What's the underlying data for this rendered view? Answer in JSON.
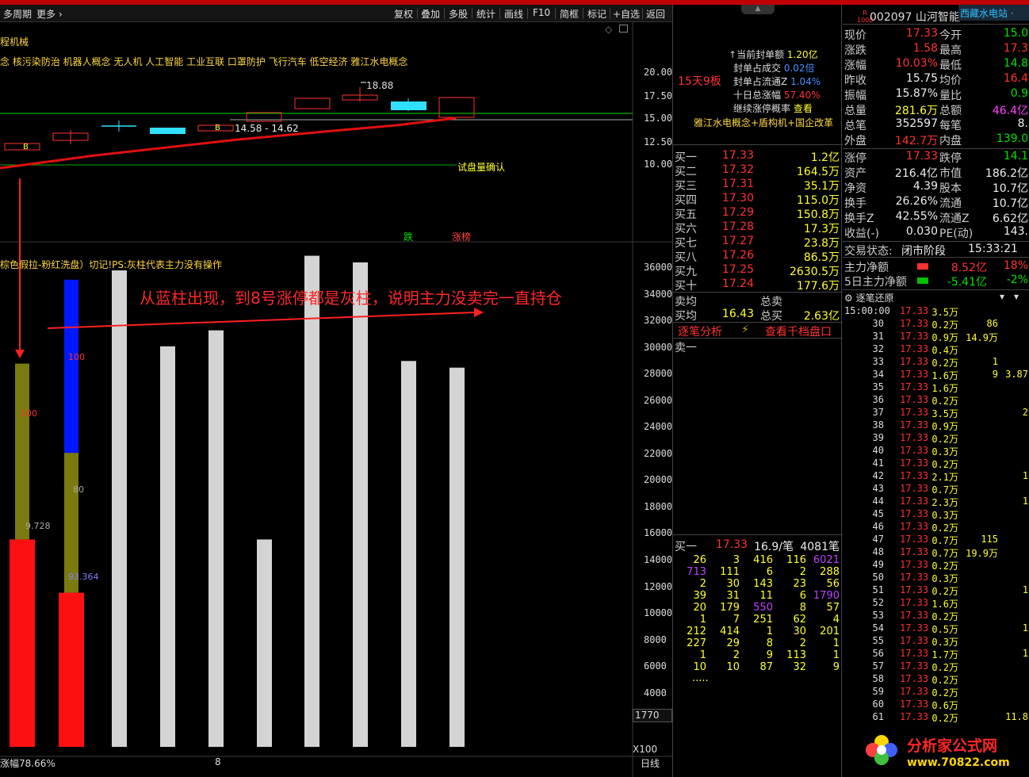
{
  "toolbar": {
    "left_partial": "多周期",
    "more": "更多",
    "buttons": [
      "复权",
      "叠加",
      "多股",
      "统计",
      "画线",
      "F10",
      "简框",
      "标记",
      "+自选",
      "返回"
    ]
  },
  "chart": {
    "sector": "程机械",
    "concepts": "念 核污染防治 机器人概念 无人机 人工智能 工业互联 口罩防护 飞行汽车 低空经济 雅江水电概念",
    "price_axis": [
      "20.00",
      "17.50",
      "15.00",
      "12.50",
      "10.00"
    ],
    "peak_label": "18.88",
    "range_label": "14.58 - 14.62",
    "confirm_label": "试盘量确认",
    "b_label": "B",
    "fall_label": "跌",
    "limit_label": "涨榜",
    "indicator_hint": "棕色假拉-粉红洗盘）切记!PS:灰柱代表主力没有操作",
    "annotation": "从蓝柱出现，到8号涨停都是灰柱，说明主力没卖完一直持仓",
    "vol_axis": [
      "36000",
      "34000",
      "32000",
      "30000",
      "28000",
      "26000",
      "24000",
      "22000",
      "20000",
      "18000",
      "16000",
      "14000",
      "12000",
      "10000",
      "8000",
      "6000",
      "4000"
    ],
    "bar_val_1": "100",
    "bar_val_2": "100",
    "bar_val_3": "100",
    "bar_val_4": "80",
    "bar_val_5": "9.728",
    "bar_val_6": "93.364",
    "box_value": "1770",
    "bottom_left": "涨幅78.66%",
    "date_mark": "8",
    "x100": "X100",
    "day_line": "日线"
  },
  "chart_data": {
    "type": "bar",
    "series": [
      {
        "name": "olive",
        "values": [
          28700,
          22000
        ]
      },
      {
        "name": "red",
        "values": [
          15500,
          11500
        ]
      },
      {
        "name": "blue",
        "values": [
          null,
          35000
        ]
      },
      {
        "name": "gray",
        "values": [
          35700,
          30000,
          31200,
          15500,
          36800,
          36300,
          28900,
          28400
        ]
      }
    ]
  },
  "stock": {
    "code": "002097",
    "name": "山河智能",
    "badge_top": "R",
    "badge_bot": "1000",
    "sector_tag": "西藏水电站"
  },
  "limit": {
    "days": "15天9板",
    "seal_amount_label": "当前封单额",
    "seal_amount": "1.20亿",
    "seal_ratio_label": "封单占成交",
    "seal_ratio": "0.02倍",
    "seal_float_label": "封单占流通Z",
    "seal_float": "1.04%",
    "ten_day_label": "十日总涨幅",
    "ten_day": "57.40%",
    "prob_label": "继续涨停概率",
    "prob_link": "查看",
    "tags": "雅江水电概念+盾构机+国企改革"
  },
  "bids": [
    {
      "l": "买一",
      "p": "17.33",
      "v": "1.2亿"
    },
    {
      "l": "买二",
      "p": "17.32",
      "v": "164.5万"
    },
    {
      "l": "买三",
      "p": "17.31",
      "v": "35.1万"
    },
    {
      "l": "买四",
      "p": "17.30",
      "v": "115.0万"
    },
    {
      "l": "买五",
      "p": "17.29",
      "v": "150.8万"
    },
    {
      "l": "买六",
      "p": "17.28",
      "v": "17.3万"
    },
    {
      "l": "买七",
      "p": "17.27",
      "v": "23.8万"
    },
    {
      "l": "买八",
      "p": "17.26",
      "v": "86.5万"
    },
    {
      "l": "买九",
      "p": "17.25",
      "v": "2630.5万"
    },
    {
      "l": "买十",
      "p": "17.24",
      "v": "177.6万"
    }
  ],
  "avg": {
    "sell_label": "卖均",
    "sell_total_label": "总卖",
    "buy_label": "买均",
    "buy": "16.43",
    "buy_total_label": "总买",
    "buy_total": "2.63亿"
  },
  "tabs": {
    "tick_analysis": "逐笔分析",
    "view_1000": "查看千档盘口"
  },
  "sell1": "卖一",
  "queue": {
    "label": "买一",
    "price": "17.33",
    "per": "16.9/笔",
    "count": "4081笔",
    "rows": [
      [
        "26",
        "3",
        "416",
        "116",
        "6021"
      ],
      [
        "713",
        "111",
        "6",
        "2",
        "288"
      ],
      [
        "2",
        "30",
        "143",
        "23",
        "56"
      ],
      [
        "39",
        "31",
        "11",
        "6",
        "1790"
      ],
      [
        "20",
        "179",
        "550",
        "8",
        "57"
      ],
      [
        "1",
        "7",
        "251",
        "62",
        "4"
      ],
      [
        "212",
        "414",
        "1",
        "30",
        "201"
      ],
      [
        "227",
        "29",
        "8",
        "2",
        "1"
      ],
      [
        "1",
        "2",
        "9",
        "113",
        "1"
      ],
      [
        "10",
        "10",
        "87",
        "32",
        "9"
      ]
    ],
    "more": "....."
  },
  "quote": {
    "rows": [
      {
        "l1": "现价",
        "v1": "17.33",
        "c1": "red",
        "l2": "今开",
        "v2": "15.0",
        "c2": "green"
      },
      {
        "l1": "涨跌",
        "v1": "1.58",
        "c1": "red",
        "l2": "最高",
        "v2": "17.3",
        "c2": "red"
      },
      {
        "l1": "涨幅",
        "v1": "10.03%",
        "c1": "red",
        "l2": "最低",
        "v2": "14.8",
        "c2": "green"
      },
      {
        "l1": "昨收",
        "v1": "15.75",
        "c1": "wht",
        "l2": "均价",
        "v2": "16.4",
        "c2": "red"
      },
      {
        "l1": "振幅",
        "v1": "15.87%",
        "c1": "wht",
        "l2": "量比",
        "v2": "0.9",
        "c2": "green"
      },
      {
        "l1": "总量",
        "v1": "281.6万",
        "c1": "yel",
        "l2": "总额",
        "v2": "46.4亿",
        "c2": "mag"
      },
      {
        "l1": "总笔",
        "v1": "352597",
        "c1": "wht",
        "l2": "每笔",
        "v2": "8.",
        "c2": "wht"
      },
      {
        "l1": "外盘",
        "v1": "142.7万",
        "c1": "red",
        "l2": "内盘",
        "v2": "139.0",
        "c2": "green"
      }
    ],
    "rows2": [
      {
        "l1": "涨停",
        "v1": "17.33",
        "c1": "red",
        "l2": "跌停",
        "v2": "14.1",
        "c2": "green"
      },
      {
        "l1": "资产",
        "v1": "216.4亿",
        "c1": "wht",
        "l2": "市值",
        "v2": "186.2亿",
        "c2": "wht"
      },
      {
        "l1": "净资",
        "v1": "4.39",
        "c1": "wht",
        "l2": "股本",
        "v2": "10.7亿",
        "c2": "wht"
      },
      {
        "l1": "换手",
        "v1": "26.26%",
        "c1": "wht",
        "l2": "流通",
        "v2": "10.7亿",
        "c2": "wht"
      },
      {
        "l1": "换手Z",
        "v1": "42.55%",
        "c1": "wht",
        "l2": "流通Z",
        "v2": "6.62亿",
        "c2": "wht"
      },
      {
        "l1": "收益(-)",
        "v1": "0.030",
        "c1": "wht",
        "l2": "PE(动)",
        "v2": "143.",
        "c2": "wht"
      }
    ],
    "status_label": "交易状态:",
    "status": "闭市阶段",
    "time": "15:33:21",
    "main_net_label": "主力净额",
    "main_net": "8.52亿",
    "main_net_pct": "18%",
    "five_net_label": "5日主力净额",
    "five_net": "-5.41亿",
    "five_net_pct": "-2%"
  },
  "ticks": {
    "title": "逐笔还原",
    "first_time": "15:00:00",
    "price": "17.33",
    "rows": [
      [
        "15:00:00",
        "3.5万",
        "",
        ""
      ],
      [
        "30",
        "0.2万",
        "86",
        ""
      ],
      [
        "31",
        "0.9万",
        "14.9万",
        ""
      ],
      [
        "32",
        "0.4万",
        "",
        ""
      ],
      [
        "33",
        "0.2万",
        "1",
        ""
      ],
      [
        "34",
        "1.6万",
        "9",
        "3.87"
      ],
      [
        "35",
        "1.6万",
        "",
        ""
      ],
      [
        "36",
        "0.2万",
        "",
        ""
      ],
      [
        "37",
        "3.5万",
        "",
        "2"
      ],
      [
        "38",
        "0.9万",
        "",
        ""
      ],
      [
        "39",
        "0.2万",
        "",
        ""
      ],
      [
        "40",
        "0.3万",
        "",
        ""
      ],
      [
        "41",
        "0.2万",
        "",
        ""
      ],
      [
        "42",
        "2.1万",
        "",
        "1"
      ],
      [
        "43",
        "0.7万",
        "",
        ""
      ],
      [
        "44",
        "2.3万",
        "",
        "1"
      ],
      [
        "45",
        "0.3万",
        "",
        ""
      ],
      [
        "46",
        "0.2万",
        "",
        ""
      ],
      [
        "47",
        "0.7万",
        "115",
        ""
      ],
      [
        "48",
        "0.7万",
        "19.9万",
        ""
      ],
      [
        "49",
        "0.2万",
        "",
        ""
      ],
      [
        "50",
        "0.3万",
        "",
        ""
      ],
      [
        "51",
        "0.2万",
        "",
        "1"
      ],
      [
        "52",
        "1.6万",
        "",
        ""
      ],
      [
        "53",
        "0.2万",
        "",
        ""
      ],
      [
        "54",
        "0.5万",
        "",
        "1"
      ],
      [
        "55",
        "0.3万",
        "",
        ""
      ],
      [
        "56",
        "1.7万",
        "",
        "1"
      ],
      [
        "57",
        "0.2万",
        "",
        ""
      ],
      [
        "58",
        "0.2万",
        "",
        ""
      ],
      [
        "59",
        "0.2万",
        "",
        ""
      ],
      [
        "60",
        "0.6万",
        "",
        ""
      ],
      [
        "61",
        "0.2万",
        "",
        "11.8"
      ]
    ]
  },
  "watermark": {
    "name": "分析家公式网",
    "url": "www.70822.com"
  }
}
